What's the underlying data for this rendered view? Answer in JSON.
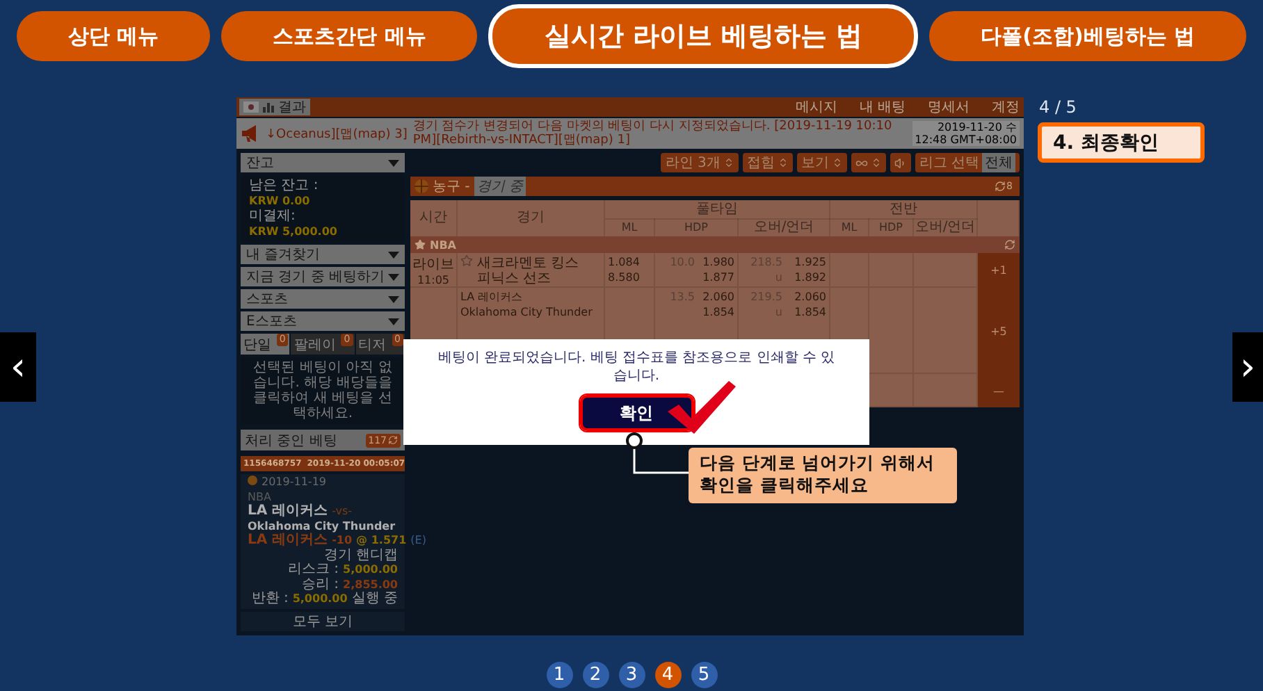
{
  "nav_tabs": [
    {
      "label": "상단 메뉴",
      "selected": false
    },
    {
      "label": "스포츠간단 메뉴",
      "selected": false
    },
    {
      "label": "실시간 라이브 베팅하는 법",
      "selected": true
    },
    {
      "label": "다폴(조합)베팅하는 법",
      "selected": false
    }
  ],
  "slide_nav": {
    "prev": "‹",
    "next": "›"
  },
  "screenshot": {
    "top_bar": {
      "left_label": "결과",
      "menu": [
        "메시지",
        "내 배팅",
        "명세서",
        "계정"
      ]
    },
    "ticker": {
      "lead": "↓Oceanus][맵(map) 3]",
      "text": "경기 점수가 변경되어 다음 마켓의 베팅이 다시 지정되었습니다. [2019-11-19 10:10 PM][Rebirth-vs-INTACT][맵(map) 1]",
      "date": "2019-11-20 수",
      "time": "12:48 GMT+08:00"
    },
    "sidebar": {
      "balance_select": "잔고",
      "balance": [
        {
          "label": "남은 잔고 :",
          "value": "KRW 0.00"
        },
        {
          "label": "미결제:",
          "value": "KRW 5,000.00"
        }
      ],
      "menus": [
        "내 즐겨찾기",
        "지금 경기 중 베팅하기",
        "스포츠",
        "E스포츠"
      ],
      "bet_tabs": [
        {
          "label": "단일",
          "count": "0",
          "selected": true
        },
        {
          "label": "팔레이",
          "count": "0",
          "selected": false
        },
        {
          "label": "티저",
          "count": "0",
          "selected": false
        }
      ],
      "empty_message": "선택된 베팅이 아직 없습니다. 해당 배당들을 클릭하여 새 베팅을 선택하세요.",
      "pending": {
        "title": "처리 중인 베팅",
        "count": "117",
        "bet_id": "1156468757",
        "placed": "2019-11-20 00:05:07",
        "date": "2019-11-19",
        "league": "NBA",
        "home": "LA 레이커스",
        "vs": "-vs-",
        "away": "Oklahoma City Thunder",
        "pick": "LA 레이커스",
        "line": "-10",
        "odds": "@ 1.571",
        "odds_type": "(E)",
        "market": "경기 핸디캡",
        "lines": [
          {
            "label": "리스크 :",
            "value": "5,000.00"
          },
          {
            "label": "승리 :",
            "value": "2,855.00"
          },
          {
            "label": "반환 :",
            "value": "5,000.00",
            "note": "실행 중"
          }
        ]
      },
      "view_all": "모두 보기"
    },
    "toolbar": {
      "selects": [
        "라인 3개",
        "접힘",
        "보기"
      ],
      "league_label": "리그 선택",
      "league_value": "전체"
    },
    "panel": {
      "sport": "농구 -",
      "status": "경기 중",
      "refresh_count": "8"
    },
    "table": {
      "time": "시간",
      "match": "경기",
      "groups": [
        {
          "label": "풀타임",
          "columns": [
            "ML",
            "HDP",
            "오버/언더"
          ]
        },
        {
          "label": "전반",
          "columns": [
            "ML",
            "HDP",
            "오버/언더"
          ]
        }
      ],
      "league": "NBA",
      "rows": [
        {
          "time": [
            "라이브",
            "11:05"
          ],
          "teams": [
            "새크라멘토 킹스",
            "피닉스 선즈"
          ],
          "ml": [
            "1.084",
            "8.580"
          ],
          "hdp_line": "10.0",
          "hdp": [
            "1.980",
            "1.877"
          ],
          "ou_line": "218.5",
          "ou_under": "u",
          "ou": [
            "1.925",
            "1.892"
          ],
          "more": "+1"
        },
        {
          "teams": [
            "LA 레이커스",
            "Oklahoma City Thunder"
          ],
          "hdp_line": "13.5",
          "hdp": [
            "2.060",
            "1.854"
          ],
          "ou_line": "219.5",
          "ou_under": "u",
          "ou": [
            "2.060",
            "1.854"
          ],
          "more": "+5"
        },
        {
          "more": "—"
        }
      ]
    }
  },
  "modal": {
    "message": "베팅이 완료되었습니다. 베팅 접수표를 참조용으로 인쇄할 수 있습니다.",
    "button": "확인"
  },
  "callout": "다음 단계로 넘어가기 위해서\n확인을 클릭해주세요",
  "side": {
    "counter": "4 / 5",
    "step": "4. 최종확인"
  },
  "pagination": [
    {
      "label": "1",
      "selected": false
    },
    {
      "label": "2",
      "selected": false
    },
    {
      "label": "3",
      "selected": false
    },
    {
      "label": "4",
      "selected": true
    },
    {
      "label": "5",
      "selected": false
    }
  ]
}
